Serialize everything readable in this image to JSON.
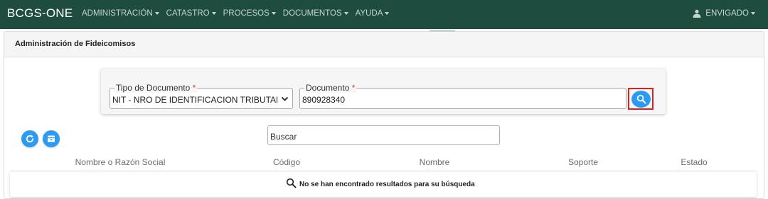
{
  "navbar": {
    "brand": "BCGS-ONE",
    "menu": [
      {
        "label": "ADMINISTRACIÓN"
      },
      {
        "label": "CATASTRO"
      },
      {
        "label": "PROCESOS"
      },
      {
        "label": "DOCUMENTOS"
      },
      {
        "label": "AYUDA"
      }
    ],
    "user": {
      "label": "ENVIGADO",
      "icon": "user-icon"
    }
  },
  "card": {
    "title": "Administración de Fideicomisos"
  },
  "search_form": {
    "tipo_documento": {
      "label": "Tipo de Documento",
      "required_mark": "*",
      "value": "NIT - NRO DE IDENTIFICACION TRIBUTARIA"
    },
    "documento": {
      "label": "Documento",
      "required_mark": "*",
      "value": "890928340"
    },
    "search_button": {
      "icon": "search-icon"
    }
  },
  "actions": {
    "refresh": {
      "icon": "refresh-icon"
    },
    "archive": {
      "icon": "archive-icon"
    }
  },
  "buscar": {
    "placeholder": "Buscar"
  },
  "table": {
    "columns": [
      "Nombre o Razón Social",
      "Código",
      "Nombre",
      "Soporte",
      "Estado"
    ],
    "empty_message": "No se han encontrado resultados para su búsqueda",
    "empty_icon": "search-icon"
  },
  "colors": {
    "navbar": "#1e4d3f",
    "accent": "#2b9af3",
    "highlight": "#e02020",
    "required": "#e53935"
  }
}
